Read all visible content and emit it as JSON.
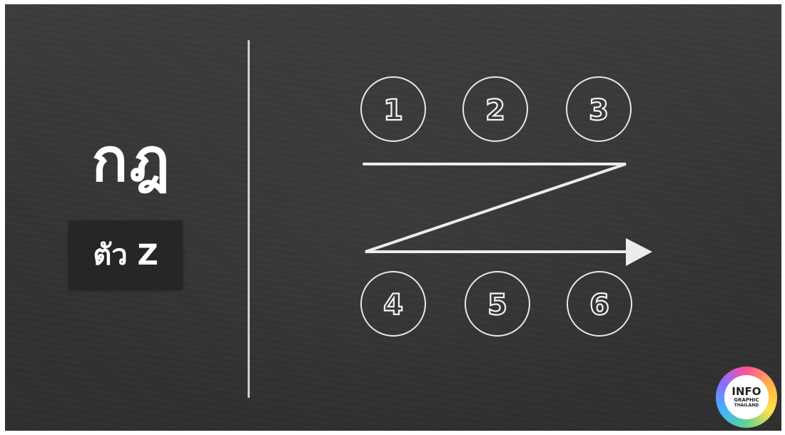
{
  "title": "กฎ",
  "label": "ตัว Z",
  "circles": {
    "top": [
      "1",
      "2",
      "3"
    ],
    "bottom": [
      "4",
      "5",
      "6"
    ]
  },
  "colors": {
    "board": "#363636",
    "chalk": "#f2f2f2",
    "label_box": "#262626"
  },
  "logo": {
    "line1": "INFO",
    "line2": "GRAPHIC",
    "line3": "THAILAND"
  }
}
